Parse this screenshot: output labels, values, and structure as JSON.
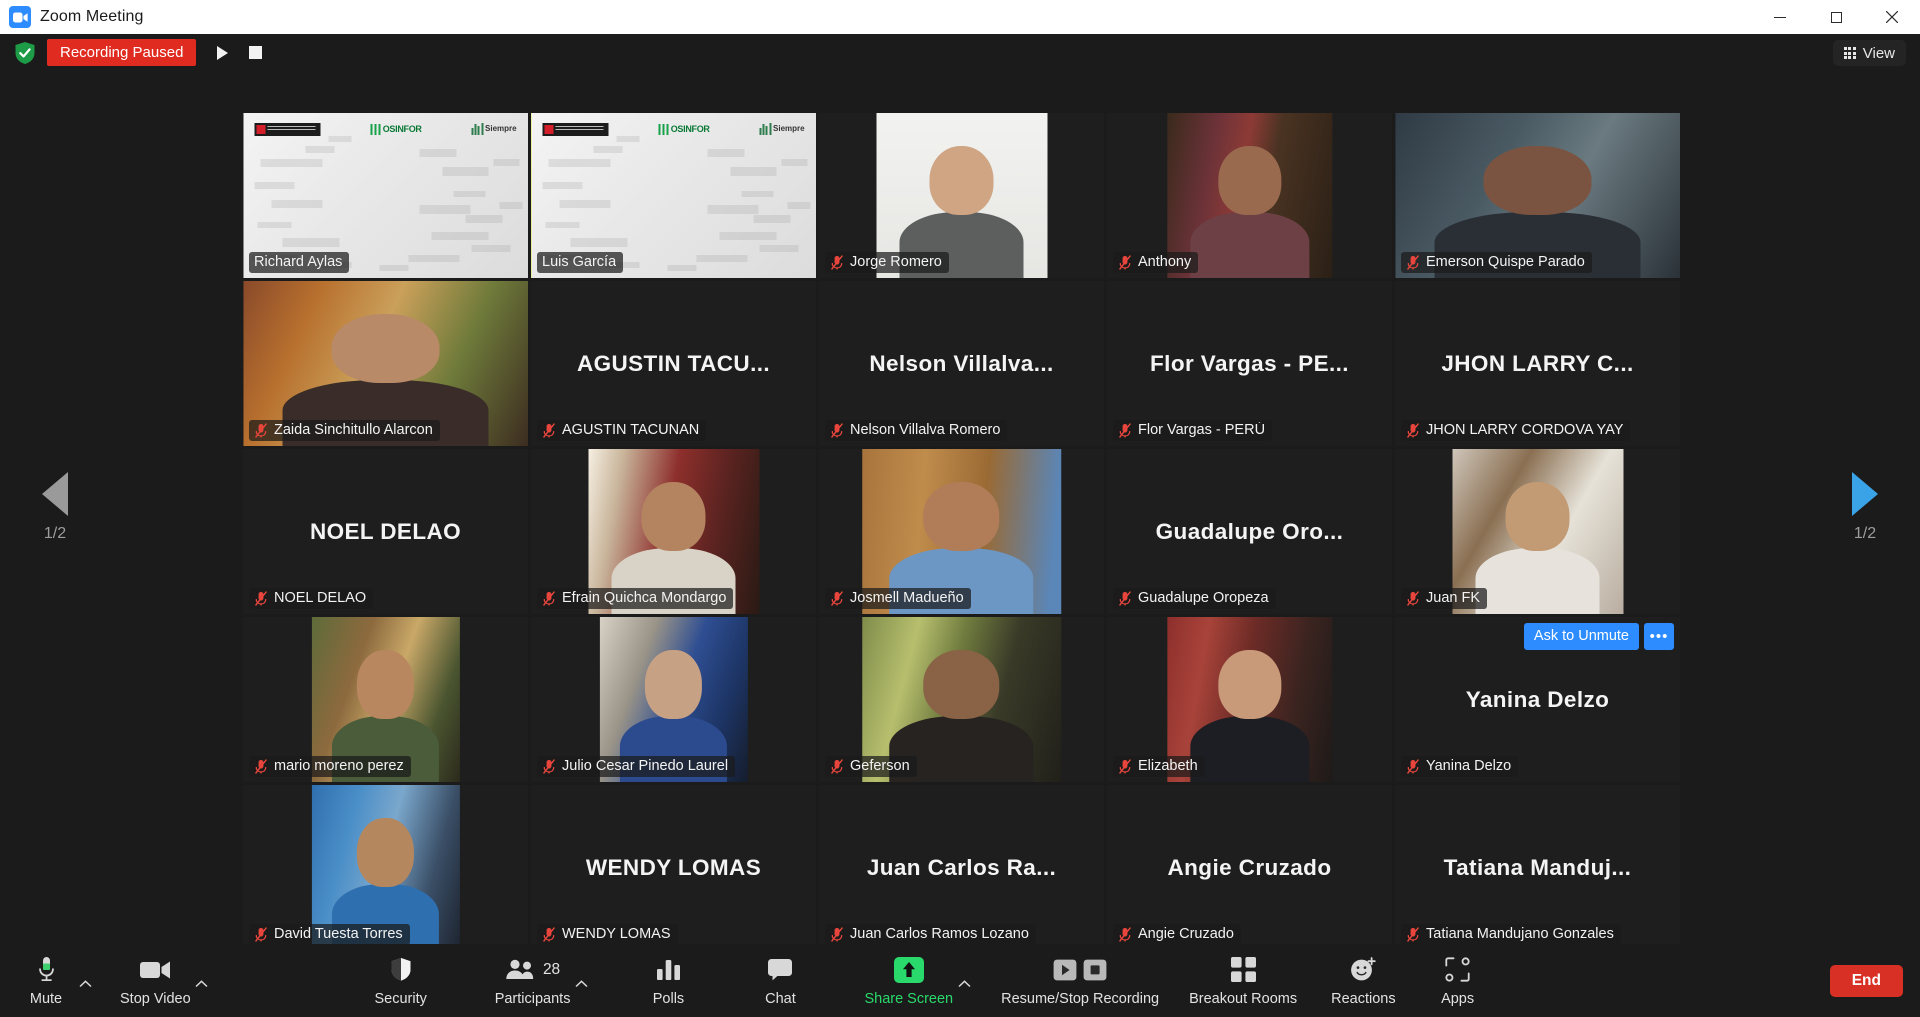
{
  "window": {
    "title": "Zoom Meeting",
    "app_icon": "zoom-camera-icon",
    "minimize": "–",
    "maximize": "☐",
    "close": "✕"
  },
  "topbar": {
    "shield_icon": "security-shield-icon",
    "recording_status": "Recording Paused",
    "resume_recording_icon": "play-icon",
    "stop_recording_icon": "stop-icon",
    "view_label": "View",
    "view_icon": "grid-icon"
  },
  "pager": {
    "prev_icon": "chevron-left-icon",
    "next_icon": "chevron-right-icon",
    "left_page": "1/2",
    "right_page": "1/2"
  },
  "tile_actions": {
    "ask_to_unmute": "Ask to Unmute",
    "more_options": "•••"
  },
  "colors": {
    "accent_blue": "#2d8cff",
    "active_speaker_border": "#e5f24a",
    "recording_red": "#e02b20",
    "end_red": "#d93025",
    "share_green": "#2ad96b",
    "muted_mic_red": "#e8463c",
    "titlebar_bg": "#ffffff",
    "app_bg": "#1b1b1b",
    "tile_bg": "#1e1e1e"
  },
  "participants": [
    {
      "name": "Richard Aylas",
      "video": true,
      "muted": false,
      "speaking": false,
      "bg": "osinfor",
      "media": "full",
      "skin": "#6d4a42",
      "shirt": "#7e3b52",
      "display_name": ""
    },
    {
      "name": "Luis García",
      "video": true,
      "muted": false,
      "speaking": true,
      "bg": "osinfor",
      "media": "full",
      "skin": "#8a5e48",
      "shirt": "#161616",
      "display_name": ""
    },
    {
      "name": "Jorge Romero",
      "video": true,
      "muted": true,
      "speaking": false,
      "bg": "photo-white",
      "media": "w60",
      "skin": "#cfa583",
      "shirt": "#5c5f5e",
      "display_name": ""
    },
    {
      "name": "Anthony",
      "video": true,
      "muted": true,
      "speaking": false,
      "bg": "photo-bookshelf",
      "media": "w58",
      "skin": "#9a6a4f",
      "shirt": "#6d4046",
      "display_name": ""
    },
    {
      "name": "Emerson Quispe Parado",
      "video": true,
      "muted": true,
      "speaking": false,
      "bg": "photo-dark-room",
      "media": "full",
      "skin": "#7a5440",
      "shirt": "#2a2f35",
      "display_name": ""
    },
    {
      "name": "Zaida Sinchitullo Alarcon",
      "video": true,
      "muted": true,
      "speaking": false,
      "bg": "photo-home",
      "media": "full",
      "skin": "#b98a68",
      "shirt": "#3a2c28",
      "display_name": ""
    },
    {
      "name": "AGUSTIN TACUNAN",
      "video": false,
      "muted": true,
      "speaking": false,
      "bg": "none",
      "media": "full",
      "display_name": "AGUSTIN TACU..."
    },
    {
      "name": "Nelson Villalva Romero",
      "video": false,
      "muted": true,
      "speaking": false,
      "bg": "none",
      "media": "full",
      "display_name": "Nelson  Villalva..."
    },
    {
      "name": "Flor Vargas - PERÚ",
      "video": false,
      "muted": true,
      "speaking": false,
      "bg": "none",
      "media": "full",
      "display_name": "Flor Vargas - PE..."
    },
    {
      "name": "JHON LARRY CORDOVA YAY",
      "video": false,
      "muted": true,
      "speaking": false,
      "bg": "none",
      "media": "full",
      "display_name": "JHON LARRY C..."
    },
    {
      "name": "NOEL DELAO",
      "video": false,
      "muted": true,
      "speaking": false,
      "bg": "none",
      "media": "full",
      "display_name": "NOEL DELAO"
    },
    {
      "name": "Efrain Quichca Mondargo",
      "video": true,
      "muted": true,
      "speaking": false,
      "bg": "photo-office-red",
      "media": "w60",
      "skin": "#b4835f",
      "shirt": "#d8d3c6",
      "display_name": ""
    },
    {
      "name": "Josmell Madueño",
      "video": true,
      "muted": true,
      "speaking": false,
      "bg": "photo-wood",
      "media": "w80",
      "skin": "#b07d58",
      "shirt": "#6c97c4",
      "display_name": ""
    },
    {
      "name": "Guadalupe Oropeza",
      "video": false,
      "muted": true,
      "speaking": false,
      "bg": "none",
      "media": "full",
      "display_name": "Guadalupe Oro..."
    },
    {
      "name": "Juan FK",
      "video": true,
      "muted": true,
      "speaking": false,
      "bg": "photo-bed",
      "media": "w60",
      "skin": "#c29a74",
      "shirt": "#e7e3dc",
      "display_name": ""
    },
    {
      "name": "mario moreno perez",
      "video": true,
      "muted": true,
      "speaking": false,
      "bg": "photo-outdoor",
      "media": "w52",
      "skin": "#b9875f",
      "shirt": "#4a5c3a",
      "display_name": ""
    },
    {
      "name": "Julio Cesar Pinedo Laurel",
      "video": true,
      "muted": true,
      "speaking": false,
      "bg": "photo-room-blue",
      "media": "w52",
      "skin": "#c7a184",
      "shirt": "#2c4b8e",
      "display_name": ""
    },
    {
      "name": "Geferson",
      "video": true,
      "muted": true,
      "speaking": false,
      "bg": "photo-garden",
      "media": "w70",
      "skin": "#8a6246",
      "shirt": "#262320",
      "display_name": ""
    },
    {
      "name": "Elizabeth",
      "video": true,
      "muted": true,
      "speaking": false,
      "bg": "photo-shelf-red",
      "media": "w58",
      "skin": "#c99a79",
      "shirt": "#1d1d24",
      "display_name": ""
    },
    {
      "name": "Yanina Delzo",
      "video": false,
      "muted": true,
      "speaking": false,
      "bg": "none",
      "media": "full",
      "display_name": "Yanina Delzo",
      "actions": true
    },
    {
      "name": "David Tuesta Torres",
      "video": true,
      "muted": true,
      "speaking": false,
      "bg": "photo-blue-wall",
      "media": "w52",
      "skin": "#b4875f",
      "shirt": "#2e6fb0",
      "display_name": ""
    },
    {
      "name": "WENDY LOMAS",
      "video": false,
      "muted": true,
      "speaking": false,
      "bg": "none",
      "media": "full",
      "display_name": "WENDY LOMAS"
    },
    {
      "name": "Juan Carlos Ramos Lozano",
      "video": false,
      "muted": true,
      "speaking": false,
      "bg": "none",
      "media": "full",
      "display_name": "Juan  Carlos  Ra..."
    },
    {
      "name": "Angie Cruzado",
      "video": false,
      "muted": true,
      "speaking": false,
      "bg": "none",
      "media": "full",
      "display_name": "Angie Cruzado"
    },
    {
      "name": "Tatiana Mandujano Gonzales",
      "video": false,
      "muted": true,
      "speaking": false,
      "bg": "none",
      "media": "full",
      "display_name": "Tatiana  Manduj..."
    }
  ],
  "toolbar": {
    "mute": {
      "label": "Mute",
      "icon": "microphone-icon"
    },
    "video": {
      "label": "Stop Video",
      "icon": "video-camera-icon"
    },
    "security": {
      "label": "Security",
      "icon": "shield-icon"
    },
    "participants": {
      "label": "Participants",
      "icon": "people-icon",
      "count": "28"
    },
    "polls": {
      "label": "Polls",
      "icon": "bar-chart-icon"
    },
    "chat": {
      "label": "Chat",
      "icon": "speech-bubble-icon"
    },
    "share": {
      "label": "Share Screen",
      "icon": "upload-arrow-icon"
    },
    "recording": {
      "label": "Resume/Stop Recording",
      "play_icon": "play-icon",
      "stop_icon": "stop-icon"
    },
    "breakout": {
      "label": "Breakout Rooms",
      "icon": "four-squares-icon"
    },
    "reactions": {
      "label": "Reactions",
      "icon": "smiley-plus-icon"
    },
    "apps": {
      "label": "Apps",
      "icon": "apps-icon"
    },
    "end": {
      "label": "End"
    }
  }
}
